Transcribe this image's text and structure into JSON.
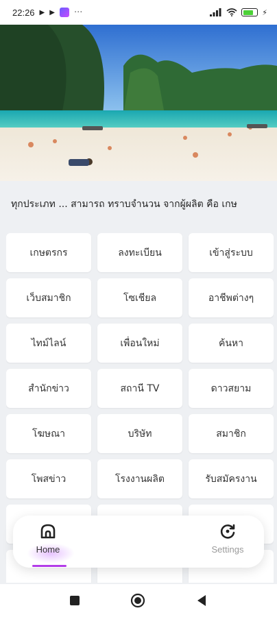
{
  "status_bar": {
    "time": "22:26",
    "overflow": "···",
    "battery_level": 0.8,
    "icons": [
      "play-icon",
      "play-icon",
      "messenger-icon",
      "signal-icon",
      "wifi-icon",
      "battery-icon",
      "charging-icon"
    ]
  },
  "banner": {
    "alt": "beach-banner-image"
  },
  "marquee": {
    "text": "ทุกประเภท ... สามารถ ทราบจำนวน จากผู้ผลิต คือ เกษ"
  },
  "grid": {
    "items": [
      {
        "label": "เกษตรกร"
      },
      {
        "label": "ลงทะเบียน"
      },
      {
        "label": "เข้าสู่ระบบ"
      },
      {
        "label": "เว็บสมาชิก"
      },
      {
        "label": "โซเชียล"
      },
      {
        "label": "อาชีพต่างๆ"
      },
      {
        "label": "ไทม์ไลน์"
      },
      {
        "label": "เพื่อนใหม่"
      },
      {
        "label": "ค้นหา"
      },
      {
        "label": "สำนักข่าว"
      },
      {
        "label": "สถานี TV"
      },
      {
        "label": "ดาวสยาม"
      },
      {
        "label": "โฆษณา"
      },
      {
        "label": "บริษัท"
      },
      {
        "label": "สมาชิก"
      },
      {
        "label": "โพสข่าว"
      },
      {
        "label": "โรงงานผลิต"
      },
      {
        "label": "รับสมัครงาน"
      },
      {
        "label": ""
      },
      {
        "label": ""
      },
      {
        "label": ""
      },
      {
        "label": ""
      },
      {
        "label": ""
      },
      {
        "label": ""
      }
    ]
  },
  "bottom_nav": {
    "home_label": "Home",
    "settings_label": "Settings",
    "accent": "#b33ce8"
  },
  "colors": {
    "background": "#eef0f3",
    "card": "#ffffff"
  }
}
